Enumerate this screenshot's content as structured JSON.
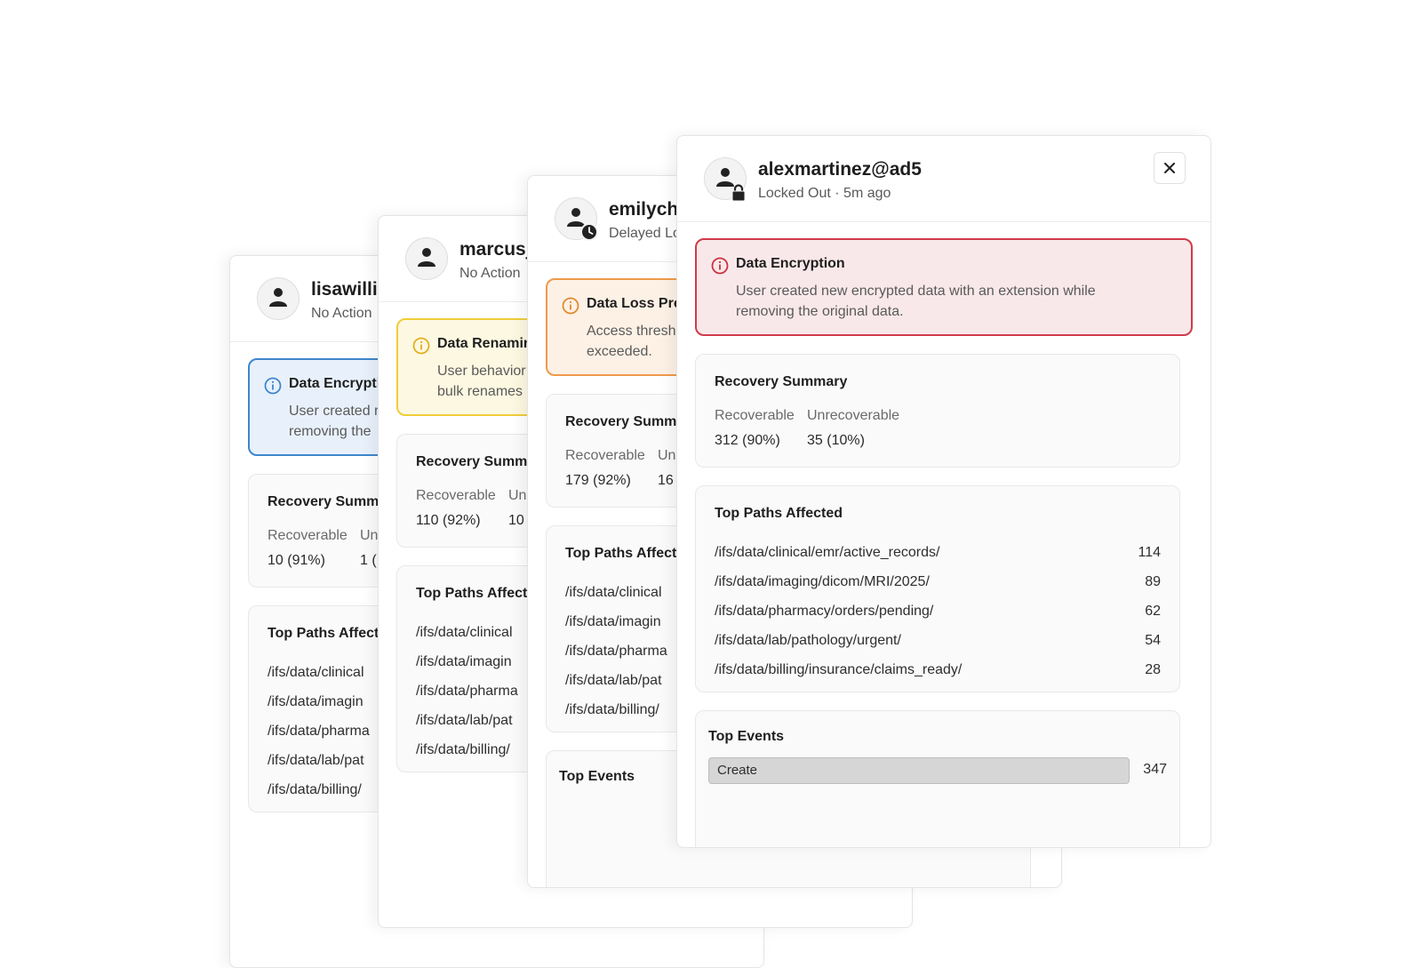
{
  "colors": {
    "info_blue": "#3e86cc",
    "warning_yellow": "#f0cd3a",
    "warning_orange": "#ee9a4a",
    "critical_red": "#cf3b4b"
  },
  "cards": [
    {
      "username": "lisawilli",
      "status": "No Action",
      "avatar_icon": "user-icon",
      "alert": {
        "severity": "info",
        "icon": "info-icon",
        "title": "Data Encrypti",
        "text": "User created r removing the"
      },
      "recovery": {
        "title": "Recovery Summ",
        "recoverable_label": "Recoverable",
        "recoverable_value": "10 (91%)",
        "unrecoverable_label": "Un",
        "unrecoverable_value": "1 ("
      },
      "paths": {
        "title": "Top Paths Affect",
        "items": [
          {
            "path": "/ifs/data/clinical",
            "count": ""
          },
          {
            "path": "/ifs/data/imagin",
            "count": ""
          },
          {
            "path": "/ifs/data/pharma",
            "count": ""
          },
          {
            "path": "/ifs/data/lab/pat",
            "count": ""
          },
          {
            "path": "/ifs/data/billing/",
            "count": ""
          }
        ]
      },
      "events": {
        "title": "",
        "items": []
      }
    },
    {
      "username": "marcusj",
      "status": "No Action",
      "avatar_icon": "user-icon",
      "alert": {
        "severity": "warning",
        "icon": "info-icon",
        "title": "Data Renamir",
        "text": "User behavior bulk renames"
      },
      "recovery": {
        "title": "Recovery Summ",
        "recoverable_label": "Recoverable",
        "recoverable_value": "110 (92%)",
        "unrecoverable_label": "Un",
        "unrecoverable_value": "10"
      },
      "paths": {
        "title": "Top Paths Affect",
        "items": [
          {
            "path": "/ifs/data/clinical",
            "count": ""
          },
          {
            "path": "/ifs/data/imagin",
            "count": ""
          },
          {
            "path": "/ifs/data/pharma",
            "count": ""
          },
          {
            "path": "/ifs/data/lab/pat",
            "count": ""
          },
          {
            "path": "/ifs/data/billing/",
            "count": ""
          }
        ]
      },
      "events": {
        "title": "",
        "items": []
      }
    },
    {
      "username": "emilych",
      "status": "Delayed Lo",
      "avatar_icon": "user-clock-icon",
      "alert": {
        "severity": "elevated",
        "icon": "info-icon",
        "title": "Data Loss Pre",
        "text": "Access thresh exceeded."
      },
      "recovery": {
        "title": "Recovery Summ",
        "recoverable_label": "Recoverable",
        "recoverable_value": "179 (92%)",
        "unrecoverable_label": "Un",
        "unrecoverable_value": "16"
      },
      "paths": {
        "title": "Top Paths Affect",
        "items": [
          {
            "path": "/ifs/data/clinical",
            "count": ""
          },
          {
            "path": "/ifs/data/imagin",
            "count": ""
          },
          {
            "path": "/ifs/data/pharma",
            "count": ""
          },
          {
            "path": "/ifs/data/lab/pat",
            "count": ""
          },
          {
            "path": "/ifs/data/billing/",
            "count": ""
          }
        ]
      },
      "events": {
        "title": "Top Events",
        "items": []
      }
    },
    {
      "username": "alexmartinez@ad5",
      "status": "Locked Out · 5m ago",
      "avatar_icon": "user-lock-icon",
      "close_icon": "close-icon",
      "alert": {
        "severity": "critical",
        "icon": "info-icon",
        "title": "Data Encryption",
        "text": "User created new encrypted data with an extension while removing the original data."
      },
      "recovery": {
        "title": "Recovery Summary",
        "recoverable_label": "Recoverable",
        "recoverable_value": "312 (90%)",
        "unrecoverable_label": "Unrecoverable",
        "unrecoverable_value": "35 (10%)"
      },
      "paths": {
        "title": "Top Paths Affected",
        "items": [
          {
            "path": "/ifs/data/clinical/emr/active_records/",
            "count": "114"
          },
          {
            "path": "/ifs/data/imaging/dicom/MRI/2025/",
            "count": "89"
          },
          {
            "path": "/ifs/data/pharmacy/orders/pending/",
            "count": "62"
          },
          {
            "path": "/ifs/data/lab/pathology/urgent/",
            "count": "54"
          },
          {
            "path": "/ifs/data/billing/insurance/claims_ready/",
            "count": "28"
          }
        ]
      },
      "events": {
        "title": "Top Events",
        "items": [
          {
            "label": "Create",
            "count": "347",
            "fill_fraction": 1.0
          }
        ]
      }
    }
  ]
}
